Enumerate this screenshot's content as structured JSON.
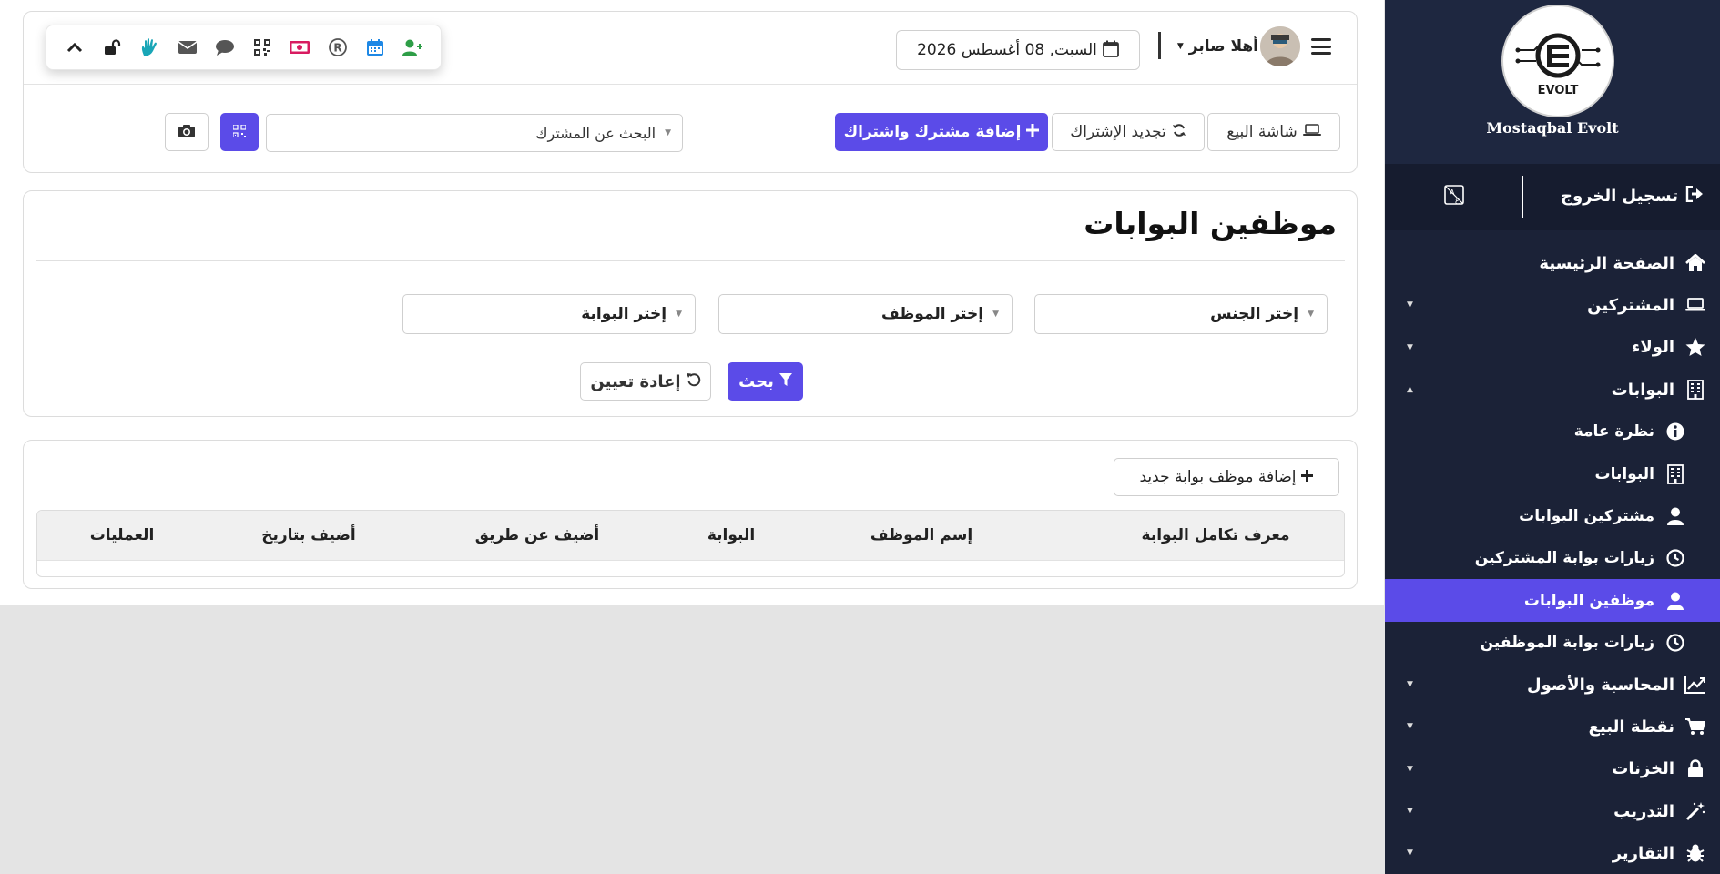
{
  "header": {
    "greeting": "أهلا صابر",
    "date": "السبت, 08 أغسطس 2026"
  },
  "toolbar": {
    "icons": [
      "chevron-up-icon",
      "unlock-icon",
      "hand-icon",
      "envelope-icon",
      "chat-icon",
      "qrcode-icon",
      "money-icon",
      "registered-icon",
      "calendar-icon",
      "add-user-icon"
    ]
  },
  "actions": {
    "pos_screen": "شاشة البيع",
    "renew_subscription": "تجديد الإشتراك",
    "add_member_subscription": "إضافة مشترك واشتراك",
    "member_search_placeholder": "البحث عن المشترك"
  },
  "page": {
    "title": "موظفين البوابات"
  },
  "filters": {
    "gender": "إختر الجنس",
    "employee": "إختر الموظف",
    "gate": "إختر البوابة",
    "search_button": "بحث",
    "reset_button": "إعادة تعيين"
  },
  "table": {
    "add_button": "إضافة موظف بوابة جديد",
    "columns": [
      "معرف تكامل البوابة",
      "إسم الموظف",
      "البوابة",
      "أضيف عن طريق",
      "أضيف بتاريخ",
      "العمليات"
    ]
  },
  "sidebar": {
    "brand_name": "Mostaqbal Evolt",
    "logo_text": "EVOLT",
    "logout": "تسجيل الخروج",
    "items": [
      {
        "label": "الصفحة الرئيسية",
        "icon": "home-icon",
        "has_caret": false,
        "sub": false,
        "active": false
      },
      {
        "label": "المشتركين",
        "icon": "laptop-icon",
        "has_caret": true,
        "sub": false,
        "active": false
      },
      {
        "label": "الولاء",
        "icon": "star-icon",
        "has_caret": true,
        "sub": false,
        "active": false
      },
      {
        "label": "البوابات",
        "icon": "building-icon",
        "has_caret": true,
        "sub": false,
        "active": false,
        "expanded": true
      },
      {
        "label": "نظرة عامة",
        "icon": "info-icon",
        "has_caret": false,
        "sub": true,
        "active": false
      },
      {
        "label": "البوابات",
        "icon": "building-icon",
        "has_caret": false,
        "sub": true,
        "active": false
      },
      {
        "label": "مشتركين البوابات",
        "icon": "user-icon",
        "has_caret": false,
        "sub": true,
        "active": false
      },
      {
        "label": "زيارات بوابة المشتركين",
        "icon": "clock-icon",
        "has_caret": false,
        "sub": true,
        "active": false
      },
      {
        "label": "موظفين البوابات",
        "icon": "user-icon",
        "has_caret": false,
        "sub": true,
        "active": true
      },
      {
        "label": "زيارات بوابة الموظفين",
        "icon": "clock-icon",
        "has_caret": false,
        "sub": true,
        "active": false
      },
      {
        "label": "المحاسبة والأصول",
        "icon": "chart-line-icon",
        "has_caret": true,
        "sub": false,
        "active": false
      },
      {
        "label": "نقطة البيع",
        "icon": "cart-icon",
        "has_caret": true,
        "sub": false,
        "active": false
      },
      {
        "label": "الخزنات",
        "icon": "lock-icon",
        "has_caret": true,
        "sub": false,
        "active": false
      },
      {
        "label": "التدريب",
        "icon": "magic-wand-icon",
        "has_caret": true,
        "sub": false,
        "active": false
      },
      {
        "label": "التقارير",
        "icon": "bug-icon",
        "has_caret": true,
        "sub": false,
        "active": false
      }
    ]
  },
  "colors": {
    "accent": "#5b4be8",
    "sidebar_bg": "#1b2237",
    "page_bg": "#e4e4e4"
  }
}
